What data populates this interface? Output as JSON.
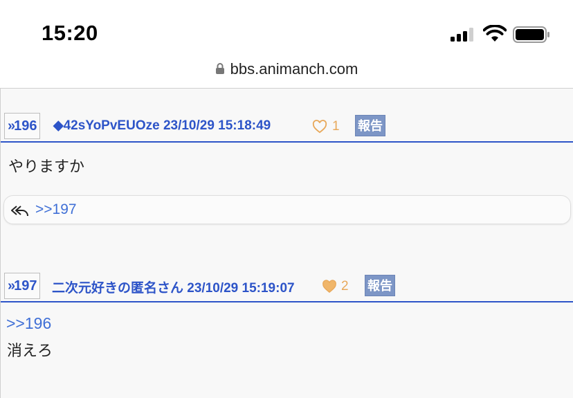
{
  "status_bar": {
    "time": "15:20"
  },
  "url_bar": {
    "domain": "bbs.animanch.com"
  },
  "posts": [
    {
      "number": "196",
      "meta": "◆42sYoPvEUOze 23/10/29 15:18:49",
      "likes": "1",
      "liked": false,
      "report_label": "報告",
      "body_lines": [
        "やりますか"
      ],
      "replies": [
        ">>197"
      ]
    },
    {
      "number": "197",
      "meta": "二次元好きの匿名さん 23/10/29 15:19:07",
      "likes": "2",
      "liked": true,
      "report_label": "報告",
      "anchor": ">>196",
      "body_lines": [
        "消えろ"
      ]
    }
  ],
  "colors": {
    "accent": "#2d54c8",
    "link": "#3f6fd6",
    "heart": "#e8a85a",
    "report_bg": "#7d96c6"
  }
}
